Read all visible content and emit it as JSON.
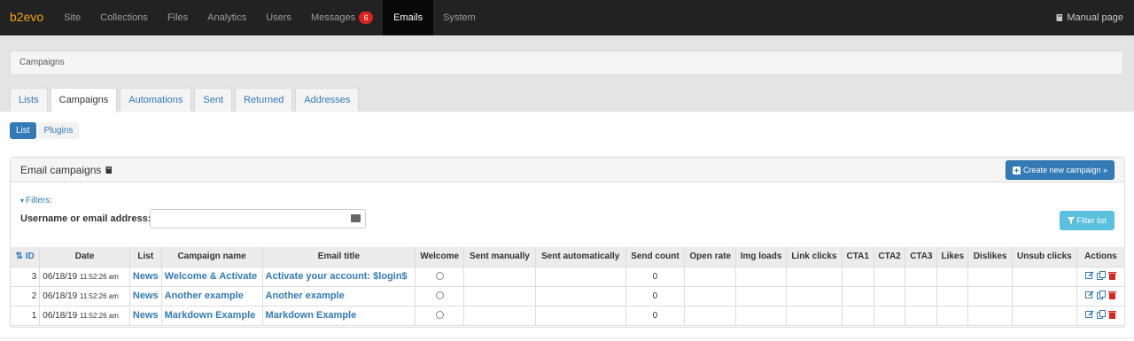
{
  "nav": {
    "brand": "b2evo",
    "items": [
      {
        "label": "Site"
      },
      {
        "label": "Collections"
      },
      {
        "label": "Files"
      },
      {
        "label": "Analytics"
      },
      {
        "label": "Users"
      },
      {
        "label": "Messages",
        "badge": "6"
      },
      {
        "label": "Emails"
      },
      {
        "label": "System"
      }
    ],
    "manual": "Manual page"
  },
  "breadcrumb": "Campaigns",
  "tabs": [
    "Lists",
    "Campaigns",
    "Automations",
    "Sent",
    "Returned",
    "Addresses"
  ],
  "subtabs": [
    "List",
    "Plugins"
  ],
  "panel": {
    "title": "Email campaigns",
    "create_button": "Create new campaign »",
    "filters_toggle": "Filters:",
    "filter_label": "Username or email address:",
    "filter_value": "",
    "filter_button": "Filter list"
  },
  "table": {
    "columns": [
      "ID",
      "Date",
      "List",
      "Campaign name",
      "Email title",
      "Welcome",
      "Sent manually",
      "Sent automatically",
      "Send count",
      "Open rate",
      "Img loads",
      "Link clicks",
      "CTA1",
      "CTA2",
      "CTA3",
      "Likes",
      "Dislikes",
      "Unsub clicks",
      "Actions"
    ],
    "rows": [
      {
        "id": "3",
        "date": "06/18/19",
        "time": "11:52:26 am",
        "list": "News",
        "name": "Welcome & Activate",
        "title": "Activate your account: $login$",
        "send_count": "0"
      },
      {
        "id": "2",
        "date": "06/18/19",
        "time": "11:52:26 am",
        "list": "News",
        "name": "Another example",
        "title": "Another example",
        "send_count": "0"
      },
      {
        "id": "1",
        "date": "06/18/19",
        "time": "11:52:26 am",
        "list": "News",
        "name": "Markdown Example",
        "title": "Markdown Example",
        "send_count": "0"
      }
    ]
  },
  "colors": {
    "nav_bg": "#222222",
    "brand": "#f0a30a",
    "link": "#337ab7",
    "badge": "#d9251d",
    "info_button": "#5bc0de"
  }
}
